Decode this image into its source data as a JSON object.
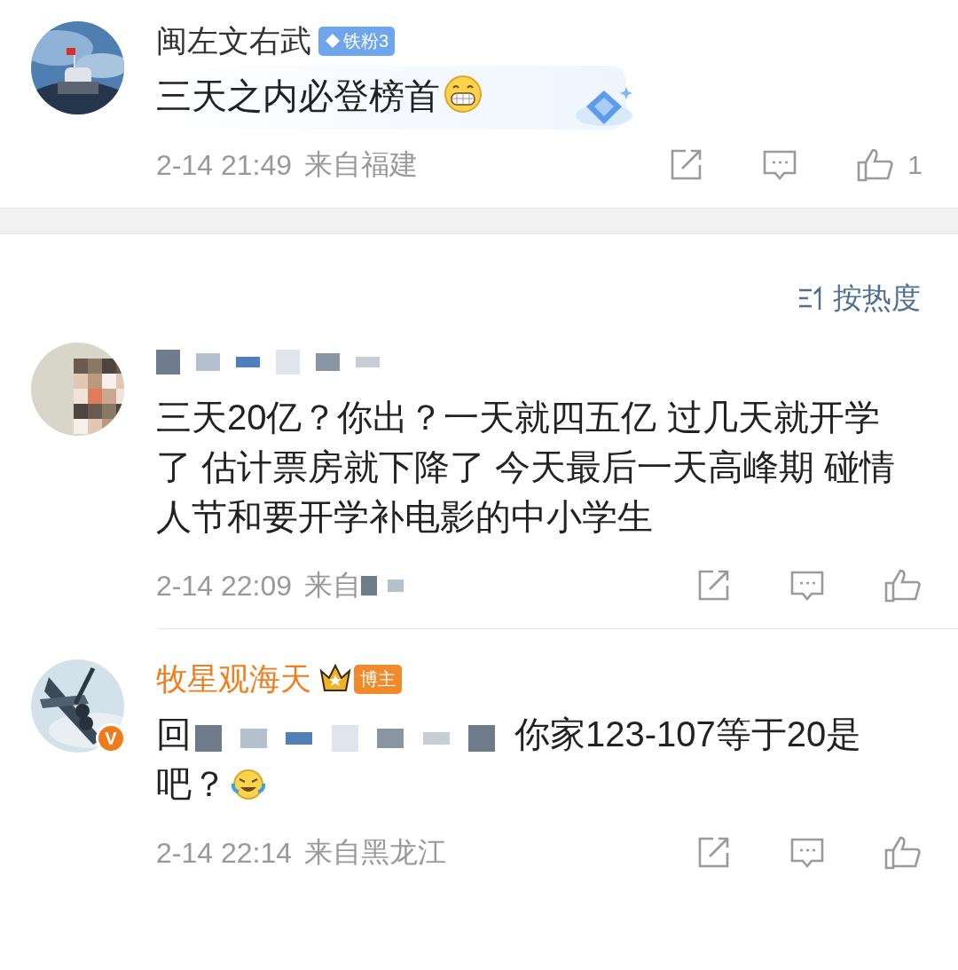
{
  "comments": [
    {
      "name": "闽左文右武",
      "badge": {
        "kind": "fan",
        "label": "铁粉3"
      },
      "bubble": true,
      "body": "三天之内必登榜首",
      "emoji": {
        "kind": "grin"
      },
      "time": "2-14 21:49",
      "location": "来自福建",
      "likes": "1"
    },
    {
      "name_redacted": true,
      "body": "三天20亿？你出？一天就四五亿 过几天就开学了 估计票房就下降了 今天最后一天高峰期 碰情人节和要开学补电影的中小学生",
      "time": "2-14 22:09",
      "location": "来自",
      "location_redacted": true
    },
    {
      "name": "牧星观海天",
      "vip": true,
      "verified": true,
      "verified_label": "V",
      "badge": {
        "kind": "blogger",
        "label": "博主"
      },
      "body_prefix": "回",
      "reply_redacted": true,
      "body": "你家123-107等于20是吧？",
      "emoji": {
        "kind": "tears"
      },
      "time": "2-14 22:14",
      "location": "来自黑龙江"
    }
  ],
  "sort": {
    "label": "按热度"
  }
}
